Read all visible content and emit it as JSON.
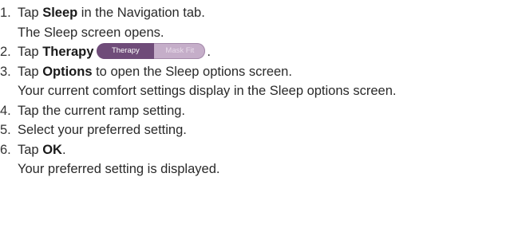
{
  "steps": [
    {
      "num": "1.",
      "before": "Tap ",
      "bold": "Sleep",
      "after": " in the Navigation tab."
    },
    {
      "sub": "The Sleep screen opens."
    },
    {
      "num": "2.",
      "before": "Tap ",
      "bold": "Therapy"
    },
    {
      "num": "3.",
      "before": "Tap ",
      "bold": "Options",
      "after": " to open the Sleep options screen."
    },
    {
      "sub": "Your current comfort settings display in the Sleep options screen."
    },
    {
      "num": "4.",
      "text": "Tap the current ramp setting."
    },
    {
      "num": "5.",
      "text": "Select your preferred setting."
    },
    {
      "num": "6.",
      "before": "Tap ",
      "bold": "OK",
      "after": "."
    },
    {
      "sub": "Your preferred setting is displayed."
    }
  ],
  "toggle": {
    "left_label": "Therapy",
    "right_label": "Mask Fit",
    "selected": "Therapy",
    "colors": {
      "active": "#6f4c79",
      "inactive": "#c5aec9"
    }
  },
  "step2_suffix": "."
}
